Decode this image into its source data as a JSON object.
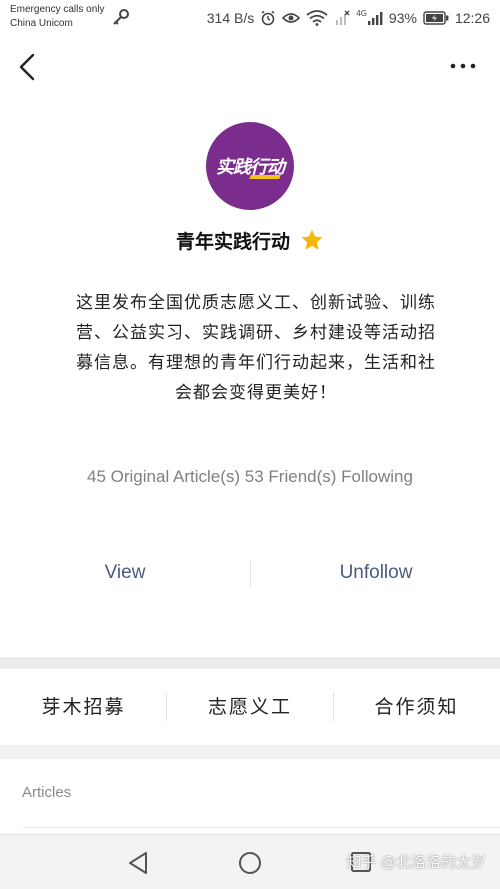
{
  "status_bar": {
    "carrier_line1": "Emergency calls only",
    "carrier_line2": "China Unicom",
    "net_speed": "314 B/s",
    "signal_label": "4G",
    "battery": "93%",
    "time": "12:26"
  },
  "profile": {
    "avatar_text": "实践行动",
    "name": "青年实践行动",
    "description": "这里发布全国优质志愿义工、创新试验、训练营、公益实习、实践调研、乡村建设等活动招募信息。有理想的青年们行动起来，生活和社会都会变得更美好！",
    "stats": "45 Original Article(s)  53 Friend(s) Following"
  },
  "actions": {
    "view_label": "View",
    "unfollow_label": "Unfollow"
  },
  "menu": {
    "items": [
      {
        "label": "芽木招募"
      },
      {
        "label": "志愿义工"
      },
      {
        "label": "合作须知"
      }
    ]
  },
  "articles": {
    "label": "Articles"
  },
  "watermark": "知乎 @北洛洛的太岁",
  "colors": {
    "avatar_bg": "#7b2d8e",
    "action_text": "#4a5b80",
    "star": "#f5b800"
  }
}
